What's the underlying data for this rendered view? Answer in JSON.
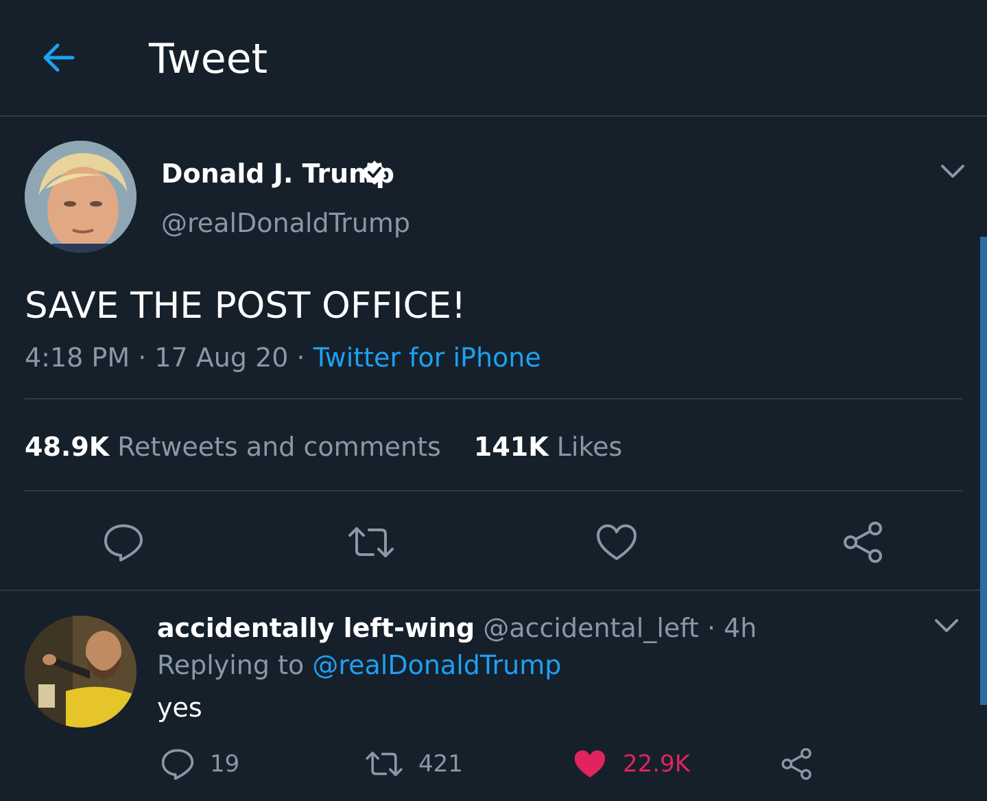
{
  "header": {
    "title": "Tweet"
  },
  "tweet": {
    "author_name": "Donald J. Trump",
    "author_handle": "@realDonaldTrump",
    "text": "SAVE THE POST OFFICE!",
    "time": "4:18 PM",
    "date": "17 Aug 20",
    "separator": " · ",
    "source": "Twitter for iPhone",
    "retweets_count": "48.9K",
    "retweets_label": "Retweets and comments",
    "likes_count": "141K",
    "likes_label": "Likes"
  },
  "reply": {
    "author_name": "accidentally left-wing",
    "author_handle": "@accidental_left",
    "time": "4h",
    "replying_prefix": "Replying to",
    "replying_handle": "@realDonaldTrump",
    "text": "yes",
    "reply_count": "19",
    "retweet_count": "421",
    "like_count": "22.9K"
  },
  "colors": {
    "background": "#15202b",
    "accent": "#1da1f2",
    "secondary_text": "#8899a6",
    "like": "#e0245e",
    "divider": "#2f3b47"
  },
  "icons": [
    "back-arrow-icon",
    "verified-badge-icon",
    "chevron-down-icon",
    "reply-icon",
    "retweet-icon",
    "like-icon",
    "share-icon"
  ]
}
